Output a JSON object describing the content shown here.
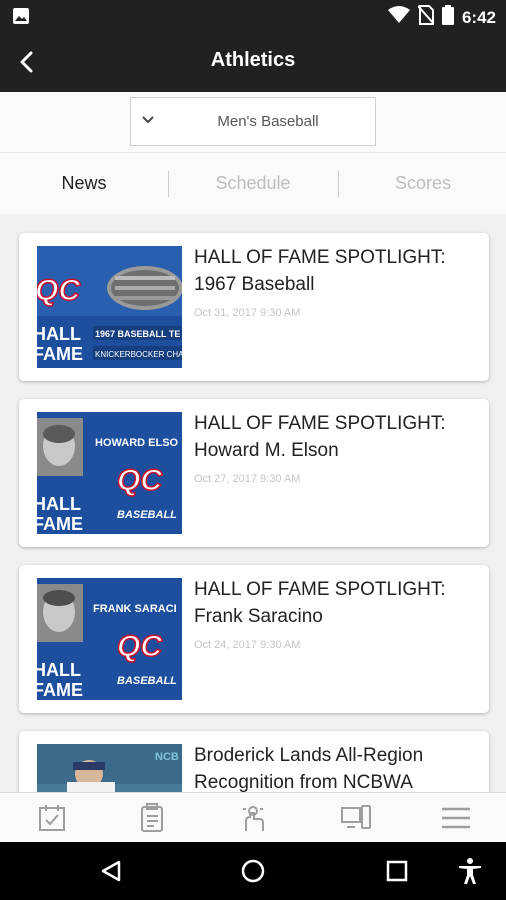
{
  "status_bar": {
    "time": "6:42",
    "icons": [
      "image-icon",
      "wifi-icon",
      "no-sim-icon",
      "battery-icon"
    ]
  },
  "app_bar": {
    "title": "Athletics",
    "back_icon": "back-arrow-icon"
  },
  "sport_selector": {
    "value": "Men's Baseball",
    "icon": "chevron-down-icon"
  },
  "tabs": [
    {
      "label": "News",
      "active": true
    },
    {
      "label": "Schedule",
      "active": false
    },
    {
      "label": "Scores",
      "active": false
    }
  ],
  "articles": [
    {
      "title": "HALL OF FAME SPOTLIGHT: 1967 Baseball",
      "date": "Oct 31, 2017 9:30 AM",
      "thumb": {
        "caption": "1967 BASEBALL TE",
        "subcaption": "KNICKERBOCKER CHAMP",
        "logo": "QC",
        "hof": [
          "HALL",
          "FAME"
        ]
      }
    },
    {
      "title": "HALL OF FAME SPOTLIGHT: Howard M. Elson",
      "date": "Oct 27, 2017 9:30 AM",
      "thumb": {
        "name": "HOWARD ELSO",
        "sport": "BASEBALL",
        "logo": "QC",
        "hof": [
          "HALL",
          "FAME"
        ]
      }
    },
    {
      "title": "HALL OF FAME SPOTLIGHT: Frank Saracino",
      "date": "Oct 24, 2017 9:30 AM",
      "thumb": {
        "name": "FRANK SARACI",
        "sport": "BASEBALL",
        "logo": "QC",
        "hof": [
          "HALL",
          "FAME"
        ]
      }
    },
    {
      "title": "Broderick Lands All-Region Recognition from NCBWA",
      "date": "",
      "thumb": {
        "banner": "NCB"
      }
    }
  ],
  "bottom_nav": [
    "checklist-calendar-icon",
    "clipboard-icon",
    "hand-touch-icon",
    "devices-icon",
    "menu-icon"
  ],
  "colors": {
    "bar_bg": "#212121",
    "thumb_blue": "#1d4f9e",
    "qc_red": "#c8102e",
    "text_dark": "#222222",
    "text_muted": "#bdbdbd"
  }
}
